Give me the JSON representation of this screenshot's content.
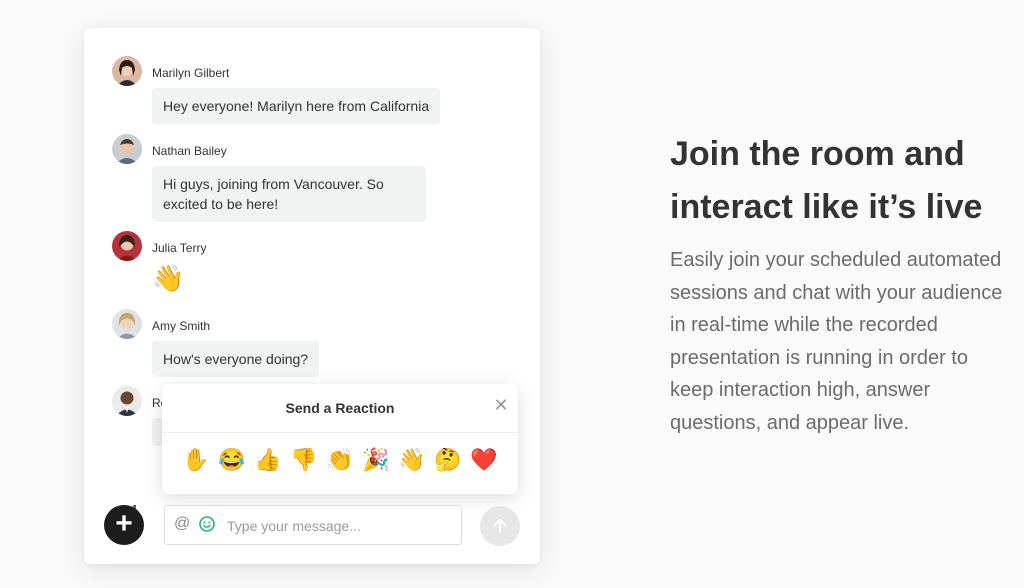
{
  "chat": {
    "messages": [
      {
        "author": "Marilyn Gilbert",
        "text": "Hey everyone! Marilyn here from California"
      },
      {
        "author": "Nathan Bailey",
        "text": "Hi guys, joining from Vancouver. So excited to be here!"
      },
      {
        "author": "Julia Terry",
        "text": "👋"
      },
      {
        "author": "Amy Smith",
        "text": "How's everyone doing?"
      },
      {
        "author": "Ro",
        "text": ""
      }
    ],
    "reaction_popup": {
      "title": "Send a Reaction",
      "close": "✕",
      "emojis": [
        "✋",
        "😂",
        "👍",
        "👎",
        "👏",
        "🎉",
        "👋",
        "🤔",
        "❤️"
      ]
    },
    "composer": {
      "add_label": "+",
      "badge": "1",
      "at_symbol": "@",
      "placeholder": "Type your message..."
    }
  },
  "marketing": {
    "headline": "Join the room and interact like it’s live",
    "description": "Easily join your scheduled automated sessions and chat with your audience in real-time while the recorded presentation is running in order to keep interaction high, answer questions, and appear live."
  }
}
